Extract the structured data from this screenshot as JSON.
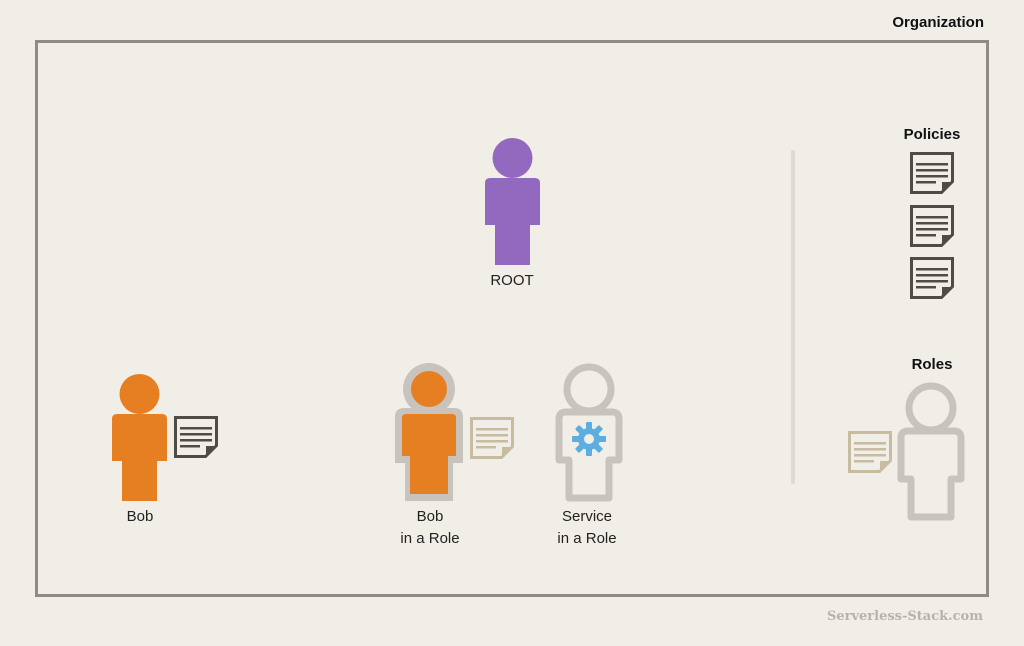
{
  "organization": {
    "title": "Organization"
  },
  "actors": {
    "root": "ROOT",
    "bob": "Bob",
    "bob_role_line1": "Bob",
    "bob_role_line2": "in a Role",
    "service_role_line1": "Service",
    "service_role_line2": "in a Role"
  },
  "legend": {
    "policies_title": "Policies",
    "roles_title": "Roles"
  },
  "watermark": "Serverless-Stack.com",
  "colors": {
    "background": "#f1eee8",
    "root_person": "#9269bf",
    "bob_person": "#e67e22",
    "role_outline": "#c8c4bd",
    "policy_dark": "#4f4b45",
    "policy_light": "#c8bca0",
    "gear": "#5aaee0"
  }
}
